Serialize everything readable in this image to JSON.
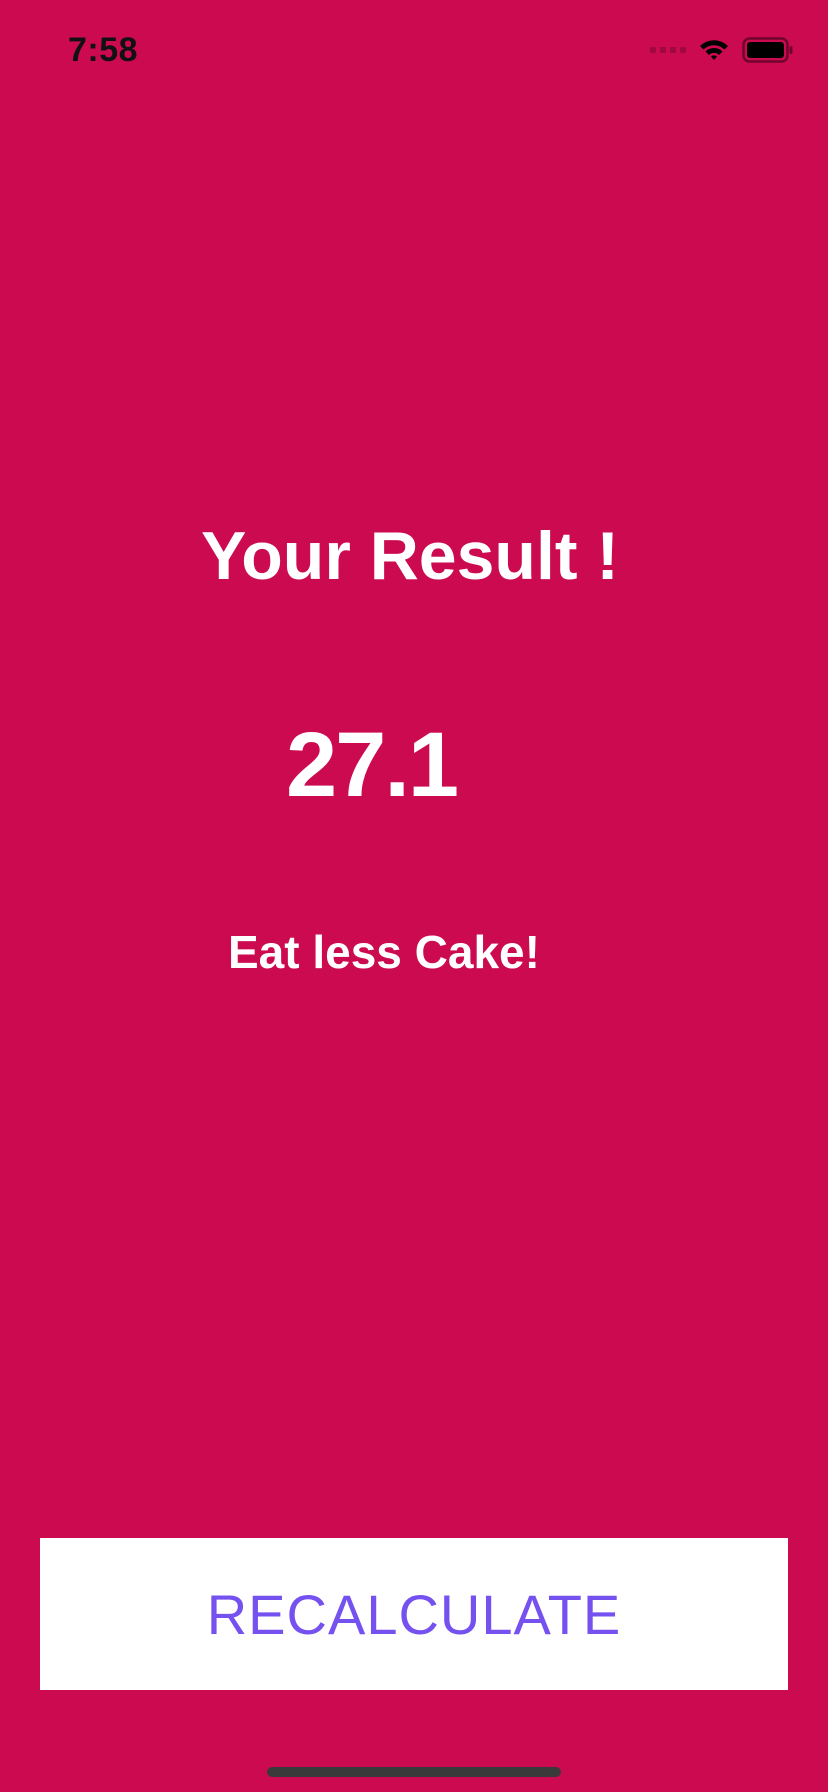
{
  "status_bar": {
    "time": "7:58",
    "icons": [
      "cellular-signal-icon",
      "wifi-icon",
      "battery-icon"
    ]
  },
  "result": {
    "title": "Your Result !",
    "value": "27.1",
    "advice": "Eat less Cake!"
  },
  "actions": {
    "recalculate_label": "RECALCULATE"
  },
  "colors": {
    "background": "#CC0A50",
    "button_background": "#FFFFFF",
    "button_text": "#7551F0",
    "text": "#FFFFFF",
    "status_icons": "#000000",
    "home_indicator": "#3A3A3A"
  }
}
